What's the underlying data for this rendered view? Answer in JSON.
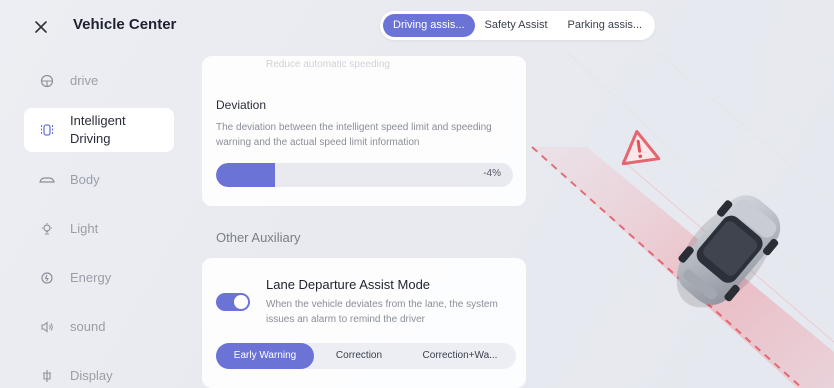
{
  "header": {
    "title": "Vehicle Center",
    "tabs": [
      {
        "label": "Driving assis...",
        "active": true
      },
      {
        "label": "Safety Assist",
        "active": false
      },
      {
        "label": "Parking assis...",
        "active": false
      }
    ]
  },
  "sidebar": {
    "items": [
      {
        "label": "drive",
        "icon": "steering-wheel-icon",
        "active": false
      },
      {
        "label": "Intelligent Driving",
        "icon": "intelligent-driving-icon",
        "active": true
      },
      {
        "label": "Body",
        "icon": "car-body-icon",
        "active": false
      },
      {
        "label": "Light",
        "icon": "light-icon",
        "active": false
      },
      {
        "label": "Energy",
        "icon": "energy-icon",
        "active": false
      },
      {
        "label": "sound",
        "icon": "speaker-icon",
        "active": false
      },
      {
        "label": "Display",
        "icon": "display-icon",
        "active": false
      }
    ]
  },
  "deviation": {
    "faded_text": "Reduce automatic speeding",
    "title": "Deviation",
    "description": "The deviation between the intelligent speed limit and speeding warning and the actual speed limit information",
    "value_label": "-4%",
    "fill_fraction": 0.2
  },
  "other_auxiliary": {
    "section_label": "Other Auxiliary"
  },
  "lane_departure": {
    "title": "Lane Departure Assist Mode",
    "description": "When the vehicle deviates from the lane, the system issues an alarm to remind the driver",
    "toggle_on": true,
    "options": [
      {
        "label": "Early Warning",
        "active": true
      },
      {
        "label": "Correction",
        "active": false
      },
      {
        "label": "Correction+Wa...",
        "active": false
      }
    ]
  },
  "colors": {
    "accent": "#6b74d6",
    "warning": "#e4505a"
  }
}
